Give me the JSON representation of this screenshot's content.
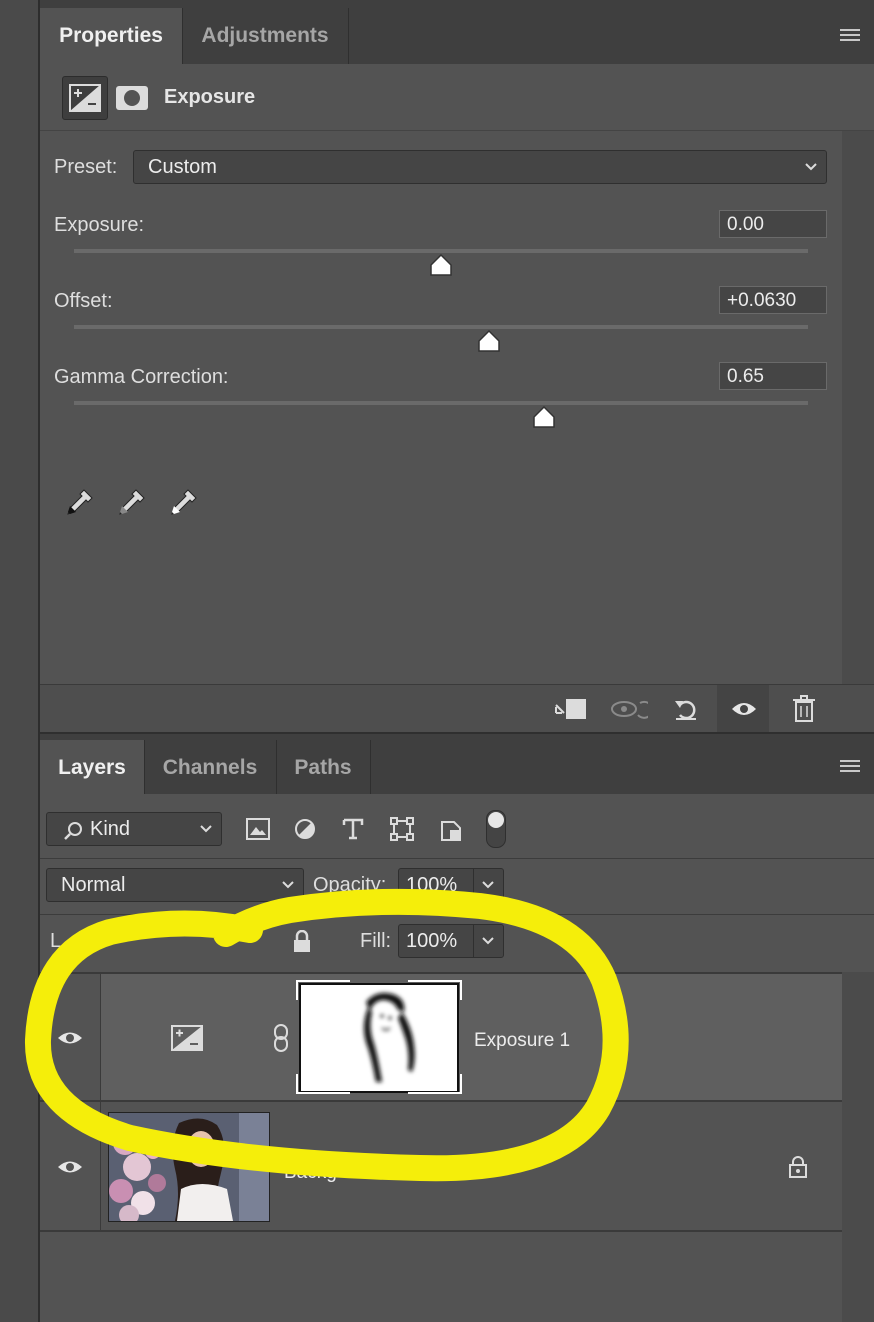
{
  "properties_panel": {
    "tabs": [
      {
        "label": "Properties",
        "active": true
      },
      {
        "label": "Adjustments",
        "active": false
      }
    ],
    "header_title": "Exposure",
    "preset_label": "Preset:",
    "preset_value": "Custom",
    "sliders": [
      {
        "label": "Exposure:",
        "value": "0.00",
        "position_fraction": 0.5
      },
      {
        "label": "Offset:",
        "value": "+0.0630",
        "position_fraction": 0.565
      },
      {
        "label": "Gamma Correction:",
        "value": "0.65",
        "position_fraction": 0.64
      }
    ],
    "eyedropper_icons": [
      "black-point-eyedropper-icon",
      "gray-point-eyedropper-icon",
      "white-point-eyedropper-icon"
    ],
    "bottom_icons": [
      "clip-to-layer-icon",
      "view-previous-state-icon",
      "reset-icon",
      "visibility-eye-icon",
      "trash-icon"
    ]
  },
  "layers_panel": {
    "tabs": [
      {
        "label": "Layers",
        "active": true
      },
      {
        "label": "Channels",
        "active": false
      },
      {
        "label": "Paths",
        "active": false
      }
    ],
    "filter_kind": "Kind",
    "blend_mode": "Normal",
    "opacity_label": "Opacity:",
    "opacity_value": "100%",
    "fill_label": "Fill:",
    "fill_value": "100%",
    "layers": [
      {
        "name": "Exposure 1",
        "type": "adjustment",
        "visible": true
      },
      {
        "name": "Backg",
        "type": "image",
        "visible": true,
        "locked": true
      }
    ]
  },
  "colors": {
    "annotation_yellow": "#f5ee0a",
    "panel_bg": "#535353",
    "tab_bar_bg": "#3f3f3f"
  }
}
